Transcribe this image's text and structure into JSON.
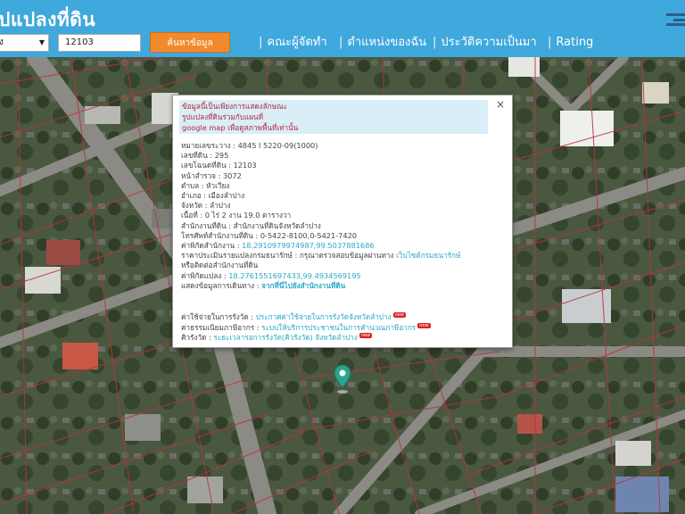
{
  "header": {
    "title": "ปแปลงที่ดิน",
    "search_select_value": "ง",
    "search_input_value": "12103",
    "search_button_label": "ค้นหาข้อมูล",
    "nav": [
      "คณะผู้จัดทำ",
      "ตำแหน่งของฉัน",
      "ประวัติความเป็นมา",
      "Rating"
    ],
    "colors": {
      "bar": "#3fa8dd",
      "button": "#f08a2c"
    }
  },
  "popup": {
    "notice": [
      "ข้อมูลนี้เป็นเพียงการแสดงลักษณะ",
      "รูปแปลงที่ดินร่วมกับแผนที่",
      "google map เพื่อดูสภาพพื้นที่เท่านั้น"
    ],
    "rows": [
      {
        "label": "หมายเลขระวาง",
        "value": "4845 I 5220-09(1000)"
      },
      {
        "label": "เลขที่ดิน",
        "value": "295"
      },
      {
        "label": "เลขโฉนดที่ดิน",
        "value": "12103"
      },
      {
        "label": "หน้าสำรวจ",
        "value": "3072"
      },
      {
        "label": "ตำบล",
        "value": "หัวเวียง"
      },
      {
        "label": "อำเภอ",
        "value": "เมืองลำปาง"
      },
      {
        "label": "จังหวัด",
        "value": "ลำปาง"
      },
      {
        "label": "เนื้อที่",
        "value": "0 ไร่ 2 งาน 19.0 ตารางวา"
      },
      {
        "label": "สำนักงานที่ดิน",
        "value": "สำนักงานที่ดินจังหวัดลำปาง"
      },
      {
        "label": "โทรศัพท์สำนักงานที่ดิน",
        "value": "0-5422-8100,0-5421-7420"
      }
    ],
    "office_coord_label": "ค่าพิกัดสำนักงาน",
    "office_coord_value": "18.2910979974987,99.5037881686",
    "price_label": "ราคาประเมินรายแปลงกรมธนารักษ์",
    "price_text": "กรุณาตรวจสอบข้อมูลผ่านทาง",
    "price_link": "เว็บไซต์กรมธนารักษ์",
    "price_text2": "หรือติดต่อสำนักงานที่ดิน",
    "parcel_coord_label": "ค่าพิกัดแปลง",
    "parcel_coord_value": "18.2761551697433,99.4934569195",
    "route_label": "แสดงข้อมูลการเดินทาง",
    "route_link": "จากที่นี่ไปยังสำนักงานที่ดิน",
    "extra_links": [
      {
        "label": "ค่าใช้จ่ายในการรังวัด",
        "link": "ประกาศค่าใช้จ่ายในการรังวัดจังหวัดลำปาง",
        "badge": "new"
      },
      {
        "label": "ค่าธรรมเนียมภาษีอากร",
        "link": "ระบบให้บริการประชาชนในการคำนวณภาษีอากร",
        "badge": "new"
      },
      {
        "label": "คิวรังวัด",
        "link": "ระยะเวลารอการรังวัด(คิวรังวัด) จังหวัดลำปาง",
        "badge": "new"
      }
    ],
    "close_symbol": "×"
  },
  "map": {
    "marker_icon": "map-pin-icon",
    "parcel_line_color": "#b8333f"
  }
}
